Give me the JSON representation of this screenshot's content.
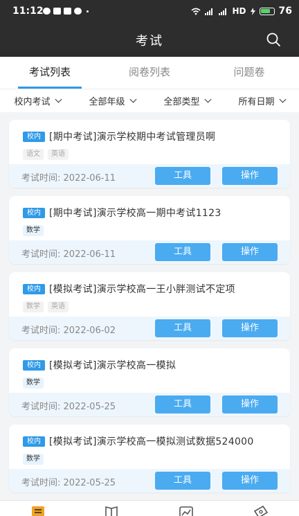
{
  "status_bar": {
    "time": "11:12",
    "network": "HD",
    "battery": "76",
    "colors": {
      "bg": "#2d2d2d",
      "battery_fill": "#53d769"
    }
  },
  "header": {
    "title": "考试",
    "search_icon": "search-icon"
  },
  "tabs": [
    {
      "label": "考试列表",
      "active": true
    },
    {
      "label": "阅卷列表",
      "active": false
    },
    {
      "label": "问题卷",
      "active": false
    }
  ],
  "filters": [
    {
      "label": "校内考试"
    },
    {
      "label": "全部年级"
    },
    {
      "label": "全部类型"
    },
    {
      "label": "所有日期"
    }
  ],
  "accent": "#2f9ae8",
  "exams": [
    {
      "badge": "校内",
      "title": "[期中考试]演示学校期中考试管理员啊",
      "subjects": [
        {
          "name": "语文",
          "muted": true
        },
        {
          "name": "英语",
          "muted": true
        }
      ],
      "time_label": "考试时间:",
      "time_value": "2022-06-11",
      "tool_label": "工具",
      "op_label": "操作"
    },
    {
      "badge": "校内",
      "title": "[期中考试]演示学校高一期中考试1123",
      "subjects": [
        {
          "name": "数学",
          "muted": false
        }
      ],
      "time_label": "考试时间:",
      "time_value": "2022-06-11",
      "tool_label": "工具",
      "op_label": "操作"
    },
    {
      "badge": "校内",
      "title": "[模拟考试]演示学校高一王小胖测试不定项",
      "subjects": [
        {
          "name": "数学",
          "muted": true
        },
        {
          "name": "英语",
          "muted": true
        }
      ],
      "time_label": "考试时间:",
      "time_value": "2022-06-02",
      "tool_label": "工具",
      "op_label": "操作"
    },
    {
      "badge": "校内",
      "title": "[模拟考试]演示学校高一模拟",
      "subjects": [
        {
          "name": "数学",
          "muted": false
        }
      ],
      "time_label": "考试时间:",
      "time_value": "2022-05-25",
      "tool_label": "工具",
      "op_label": "操作"
    },
    {
      "badge": "校内",
      "title": "[模拟考试]演示学校高一模拟测试数据524000",
      "subjects": [
        {
          "name": "数学",
          "muted": false
        }
      ],
      "time_label": "考试时间:",
      "time_value": "2022-05-25",
      "tool_label": "工具",
      "op_label": "操作"
    }
  ],
  "bottom_nav": [
    {
      "icon": "exam-list-icon",
      "active": true
    },
    {
      "icon": "book-icon",
      "active": false
    },
    {
      "icon": "chart-icon",
      "active": false
    },
    {
      "icon": "ticket-icon",
      "active": false
    }
  ]
}
